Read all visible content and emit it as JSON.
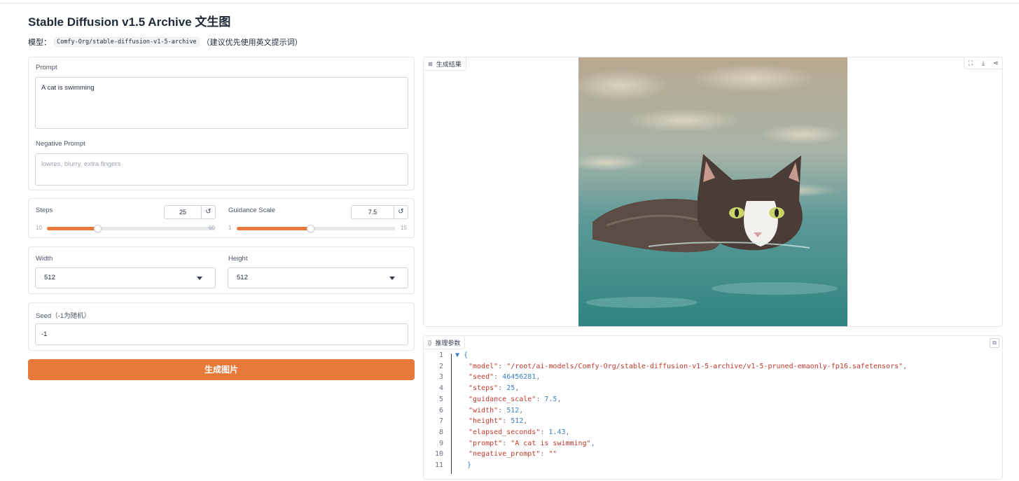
{
  "header": {
    "title": "Stable Diffusion v1.5 Archive 文生图",
    "model_prefix": "模型：",
    "model_code": "Comfy-Org/stable-diffusion-v1-5-archive",
    "model_suffix": "（建议优先使用英文提示词）"
  },
  "prompt": {
    "label": "Prompt",
    "value": "A cat is swimming"
  },
  "negative_prompt": {
    "label": "Negative Prompt",
    "placeholder": "lowres, blurry, extra fingers"
  },
  "steps": {
    "label": "Steps",
    "value": "25",
    "min": "10",
    "max": "60",
    "fraction": 0.3
  },
  "guidance": {
    "label": "Guidance Scale",
    "value": "7.5",
    "min": "1",
    "max": "15",
    "fraction": 0.4643
  },
  "width": {
    "label": "Width",
    "value": "512"
  },
  "height": {
    "label": "Height",
    "value": "512"
  },
  "seed": {
    "label": "Seed（-1为随机）",
    "value": "-1"
  },
  "generate_button": "生成图片",
  "result": {
    "tag": "生成结果",
    "tools": [
      "fullscreen-icon",
      "download-icon",
      "share-icon"
    ]
  },
  "params": {
    "tag": "推理参数",
    "line_numbers": [
      "1",
      "2",
      "3",
      "4",
      "5",
      "6",
      "7",
      "8",
      "9",
      "10",
      "11"
    ],
    "lines": [
      {
        "key": "\"model\"",
        "value": "\"/root/ai-models/Comfy-Org/stable-diffusion-v1-5-archive/v1-5-pruned-emaonly-fp16.safetensors\"",
        "type": "string",
        "comma": ","
      },
      {
        "key": "\"seed\"",
        "value": "46456281",
        "type": "number",
        "comma": ","
      },
      {
        "key": "\"steps\"",
        "value": "25",
        "type": "number",
        "comma": ","
      },
      {
        "key": "\"guidance_scale\"",
        "value": "7.5",
        "type": "number",
        "comma": ","
      },
      {
        "key": "\"width\"",
        "value": "512",
        "type": "number",
        "comma": ","
      },
      {
        "key": "\"height\"",
        "value": "512",
        "type": "number",
        "comma": ","
      },
      {
        "key": "\"elapsed_seconds\"",
        "value": "1.43",
        "type": "number",
        "comma": ","
      },
      {
        "key": "\"prompt\"",
        "value": "\"A cat is swimming\"",
        "type": "string",
        "comma": ","
      },
      {
        "key": "\"negative_prompt\"",
        "value": "\"\"",
        "type": "string",
        "comma": ""
      }
    ],
    "open_brace": "▼ {",
    "close_brace": "}"
  },
  "colors": {
    "accent": "#e8793b"
  }
}
